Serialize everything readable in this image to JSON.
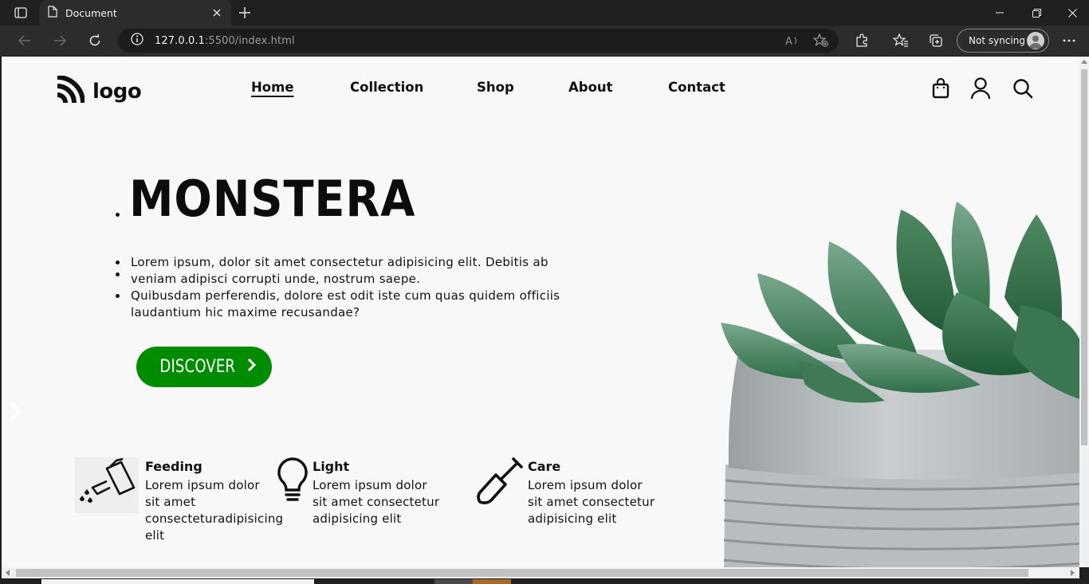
{
  "browser": {
    "tab_title": "Document",
    "url_host": "127.0.0.1",
    "url_path": ":5500/index.html",
    "sync_label": "Not syncing"
  },
  "site": {
    "logo_text": "logo",
    "nav": {
      "home": "Home",
      "collection": "Collection",
      "shop": "Shop",
      "about": "About",
      "contact": "Contact"
    },
    "hero": {
      "title": "MONSTERA",
      "lines": [
        "Lorem ipsum, dolor sit amet consectetur adipisicing elit. Debitis ab",
        "veniam adipisci corrupti unde, nostrum saepe.",
        "Quibusdam perferendis, dolore est odit iste cum quas quidem officiis",
        "laudantium hic maxime recusandae?"
      ],
      "cta": "DISCOVER",
      "cta_color": "#008c00"
    },
    "features": [
      {
        "title": "Feeding",
        "lines": [
          "Lorem ipsum dolor",
          "sit amet",
          "consecteturadipisicing",
          "elit"
        ],
        "icon": "watering-can-icon"
      },
      {
        "title": "Light",
        "lines": [
          "Lorem ipsum dolor",
          "sit amet consectetur",
          "adipisicing elit"
        ],
        "icon": "lightbulb-icon"
      },
      {
        "title": "Care",
        "lines": [
          "Lorem ipsum dolor",
          "sit amet consectetur",
          "adipisicing elit"
        ],
        "icon": "shovel-icon"
      }
    ]
  }
}
